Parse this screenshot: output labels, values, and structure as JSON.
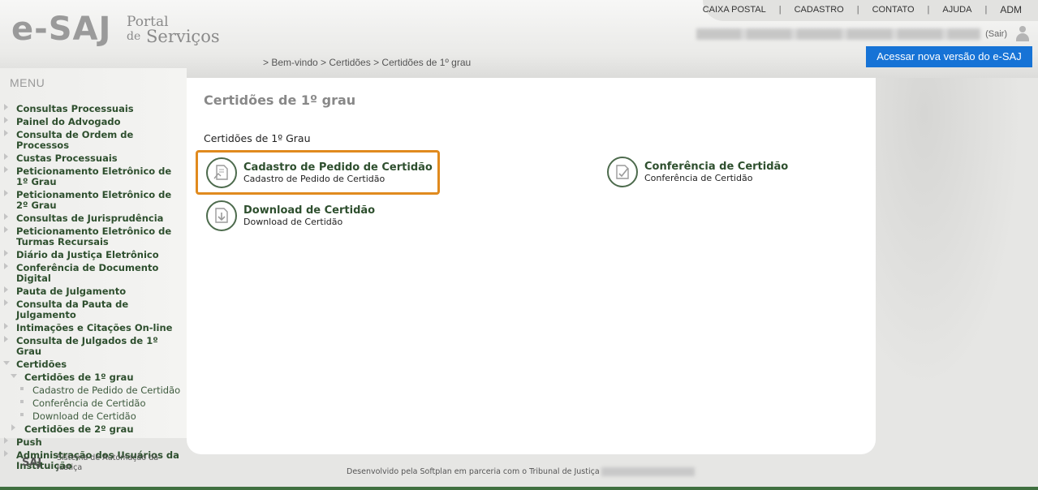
{
  "header": {
    "logo_mark": "e-SAJ",
    "logo_portal": "Portal",
    "logo_de": "de",
    "logo_servicos": "Serviços",
    "topnav": [
      "CAIXA POSTAL",
      "CADASTRO",
      "CONTATO",
      "AJUDA",
      "ADM"
    ],
    "logout": "(Sair)",
    "breadcrumb": "> Bem-vindo > Certidões > Certidões de 1º grau",
    "new_version_button": "Acessar nova versão do e-SAJ"
  },
  "sidebar": {
    "title": "MENU",
    "items": [
      {
        "label": "Consultas Processuais"
      },
      {
        "label": "Painel do Advogado"
      },
      {
        "label": "Consulta de Ordem de Processos"
      },
      {
        "label": "Custas Processuais"
      },
      {
        "label": "Peticionamento Eletrônico de 1º Grau"
      },
      {
        "label": "Peticionamento Eletrônico de 2º Grau"
      },
      {
        "label": "Consultas de Jurisprudência"
      },
      {
        "label": "Peticionamento Eletrônico de Turmas Recursais"
      },
      {
        "label": "Diário da Justiça Eletrônico"
      },
      {
        "label": "Conferência de Documento Digital"
      },
      {
        "label": "Pauta de Julgamento"
      },
      {
        "label": "Consulta da Pauta de Julgamento"
      },
      {
        "label": "Intimações e Citações On-line"
      },
      {
        "label": "Consulta de Julgados de 1º Grau"
      },
      {
        "label": "Certidões"
      },
      {
        "label": "Certidões de 1º grau"
      },
      {
        "label": "Cadastro de Pedido de Certidão"
      },
      {
        "label": "Conferência de Certidão"
      },
      {
        "label": "Download de Certidão"
      },
      {
        "label": "Certidões de 2º grau"
      },
      {
        "label": "Push"
      },
      {
        "label": "Administração dos Usuários da Instituição"
      }
    ]
  },
  "main": {
    "page_title": "Certidões de 1º grau",
    "section_title": "Certidões de 1º Grau",
    "cards": [
      {
        "title": "Cadastro de Pedido de Certidão",
        "subtitle": "Cadastro de Pedido de Certidão",
        "icon": "certificate-request-icon"
      },
      {
        "title": "Conferência de Certidão",
        "subtitle": "Conferência de Certidão",
        "icon": "certificate-check-icon"
      },
      {
        "title": "Download de Certidão",
        "subtitle": "Download de Certidão",
        "icon": "certificate-download-icon"
      }
    ]
  },
  "footer": {
    "saj_logo": "SAJ",
    "system_name": "Sistema de Automação da Justiça",
    "developed_by": "Desenvolvido pela Softplan em parceria com o Tribunal de Justiça"
  },
  "colors": {
    "accent_blue": "#1673d6",
    "menu_green": "#2e4f2e",
    "highlight_orange": "#e08a1e"
  }
}
